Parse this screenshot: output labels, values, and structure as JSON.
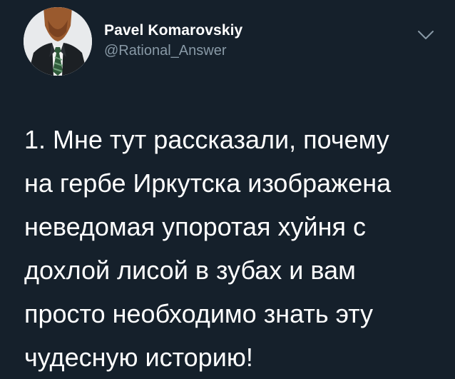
{
  "tweet": {
    "author": {
      "display_name": "Pavel Komarovskiy",
      "handle": "@Rational_Answer",
      "avatar_icon": "man-in-suit-avatar"
    },
    "menu_icon": "chevron-down-icon",
    "text": "1. Мне тут рассказали, почему\nна гербе Иркутска изображена\nневедомая упоротая хуйня с\nдохлой лисой в зубах и вам\nпросто необходимо знать эту\nчудесную историю!"
  },
  "colors": {
    "background": "#15202b",
    "primary_text": "#ffffff",
    "secondary_text": "#8899a6"
  }
}
